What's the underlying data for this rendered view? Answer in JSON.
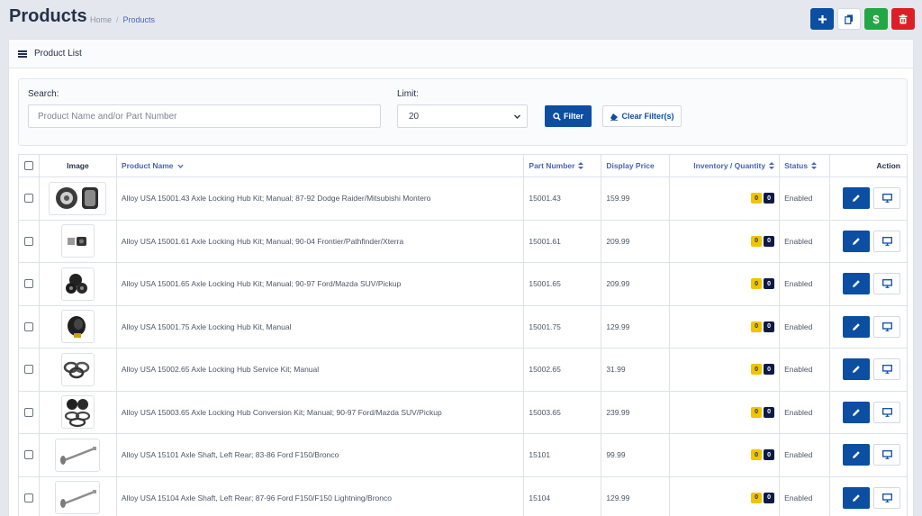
{
  "header": {
    "title": "Products",
    "breadcrumb": {
      "home": "Home",
      "separator": "/",
      "current": "Products"
    },
    "actions": {
      "add_icon": "plus-icon",
      "copy_icon": "copy-icon",
      "price_label": "$",
      "delete_icon": "trash-icon"
    }
  },
  "card": {
    "title": "Product List"
  },
  "filters": {
    "search_label": "Search:",
    "search_placeholder": "Product Name and/or Part Number",
    "search_value": "",
    "limit_label": "Limit:",
    "limit_value": "20",
    "filter_button": "Filter",
    "clear_button": "Clear Filter(s)"
  },
  "table": {
    "columns": {
      "image": "Image",
      "name": "Product Name",
      "part": "Part Number",
      "price": "Display Price",
      "inventory": "Inventory / Quantity",
      "status": "Status",
      "action": "Action"
    },
    "rows": [
      {
        "name": "Alloy USA 15001.43 Axle Locking Hub Kit; Manual; 87-92 Dodge Raider/Mitsubishi Montero",
        "part": "15001.43",
        "price": "159.99",
        "inv": "0",
        "qty": "0",
        "status": "Enabled",
        "image": "hub-kit-pair"
      },
      {
        "name": "Alloy USA 15001.61 Axle Locking Hub Kit; Manual; 90-04 Frontier/Pathfinder/Xterra",
        "part": "15001.61",
        "price": "209.99",
        "inv": "0",
        "qty": "0",
        "status": "Enabled",
        "image": "hub-kit-small"
      },
      {
        "name": "Alloy USA 15001.65 Axle Locking Hub Kit; Manual; 90-97 Ford/Mazda SUV/Pickup",
        "part": "15001.65",
        "price": "209.99",
        "inv": "0",
        "qty": "0",
        "status": "Enabled",
        "image": "hub-kit-black"
      },
      {
        "name": "Alloy USA 15001.75 Axle Locking Hub Kit, Manual",
        "part": "15001.75",
        "price": "129.99",
        "inv": "0",
        "qty": "0",
        "status": "Enabled",
        "image": "hub-single"
      },
      {
        "name": "Alloy USA 15002.65 Axle Locking Hub Service Kit; Manual",
        "part": "15002.65",
        "price": "31.99",
        "inv": "0",
        "qty": "0",
        "status": "Enabled",
        "image": "ring-set"
      },
      {
        "name": "Alloy USA 15003.65 Axle Locking Hub Conversion Kit; Manual; 90-97 Ford/Mazda SUV/Pickup",
        "part": "15003.65",
        "price": "239.99",
        "inv": "0",
        "qty": "0",
        "status": "Enabled",
        "image": "conversion-kit"
      },
      {
        "name": "Alloy USA 15101 Axle Shaft, Left Rear; 83-86 Ford F150/Bronco",
        "part": "15101",
        "price": "99.99",
        "inv": "0",
        "qty": "0",
        "status": "Enabled",
        "image": "axle-shaft"
      },
      {
        "name": "Alloy USA 15104 Axle Shaft, Left Rear; 87-96 Ford F150/F150 Lightning/Bronco",
        "part": "15104",
        "price": "129.99",
        "inv": "0",
        "qty": "0",
        "status": "Enabled",
        "image": "axle-shaft"
      }
    ]
  }
}
